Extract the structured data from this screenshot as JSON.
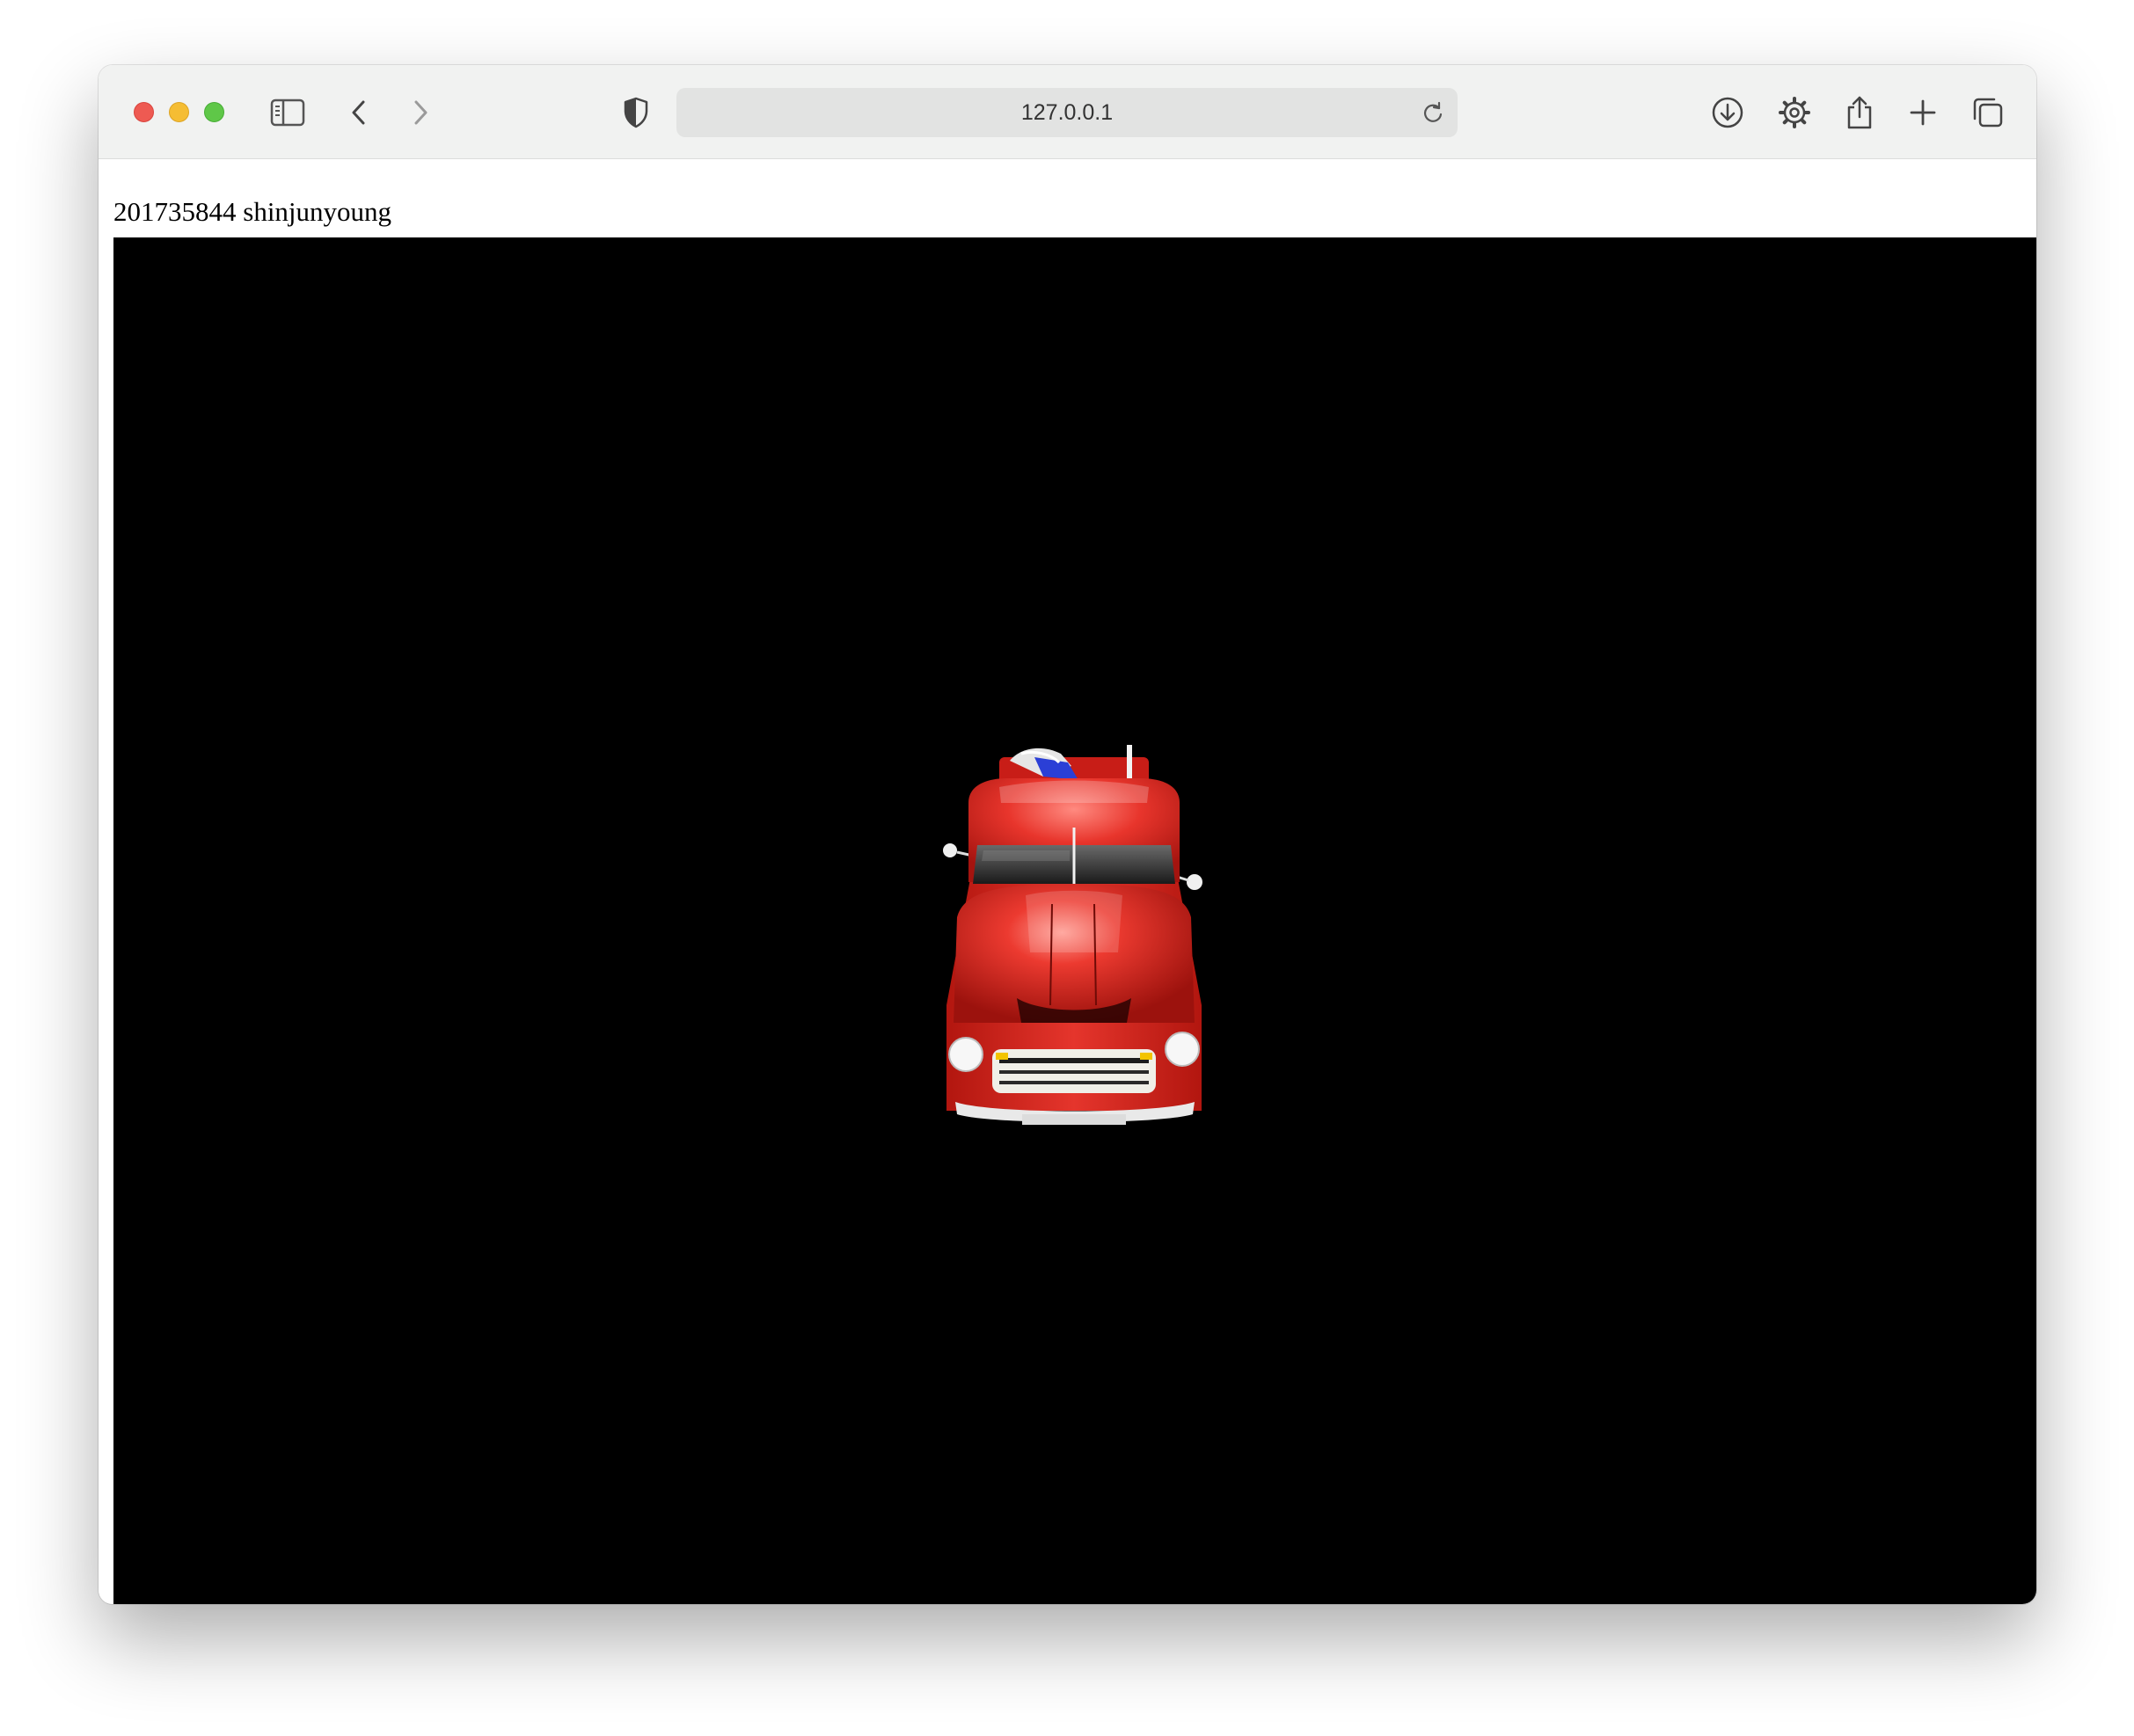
{
  "browser": {
    "url": "127.0.0.1",
    "icons": {
      "sidebar": "sidebar-icon",
      "back": "chevron-left-icon",
      "forward": "chevron-right-icon",
      "privacy": "shield-icon",
      "reload": "reload-icon",
      "downloads": "download-icon",
      "settings": "gear-icon",
      "share": "share-icon",
      "new_tab": "plus-icon",
      "tabs": "tab-overview-icon"
    }
  },
  "page": {
    "heading": "201735844 shinjunyoung",
    "canvas_background": "#000000",
    "model": "red-pickup-truck"
  },
  "colors": {
    "close": "#ee5a52",
    "minimize": "#f5bd33",
    "zoom": "#5fc748",
    "truck_body": "#d8221c"
  }
}
